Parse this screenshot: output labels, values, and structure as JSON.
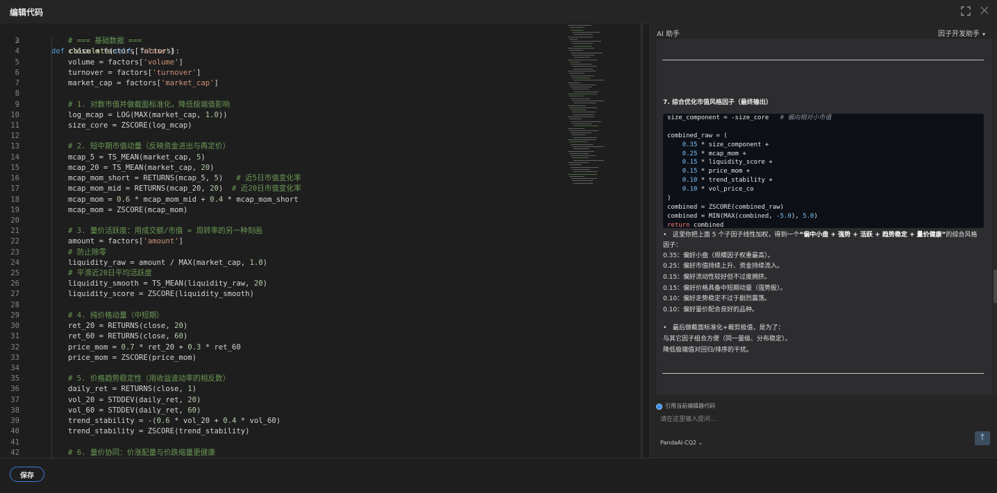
{
  "window": {
    "title": "编辑代码"
  },
  "editor": {
    "lines": [
      {
        "n": "2",
        "t": [
          [
            "",
            ""
          ]
        ]
      },
      {
        "n": "3",
        "t": [
          [
            "cm",
            "# === 基础数据 ==="
          ]
        ]
      },
      {
        "n": "4",
        "t": [
          [
            "",
            "close = factors["
          ],
          [
            "str",
            "'close'"
          ],
          [
            "",
            "]"
          ]
        ]
      },
      {
        "n": "5",
        "t": [
          [
            "",
            "volume = factors["
          ],
          [
            "str",
            "'volume'"
          ],
          [
            "",
            "]"
          ]
        ]
      },
      {
        "n": "6",
        "t": [
          [
            "",
            "turnover = factors["
          ],
          [
            "str",
            "'turnover'"
          ],
          [
            "",
            "]"
          ]
        ]
      },
      {
        "n": "7",
        "t": [
          [
            "",
            "market_cap = factors["
          ],
          [
            "str",
            "'market_cap'"
          ],
          [
            "",
            "]"
          ]
        ]
      },
      {
        "n": "8",
        "t": [
          [
            "",
            ""
          ]
        ]
      },
      {
        "n": "9",
        "t": [
          [
            "cm",
            "# 1. 对数市值并做截面标准化，降低极端值影响"
          ]
        ]
      },
      {
        "n": "10",
        "t": [
          [
            "",
            "log_mcap = LOG(MAX(market_cap, "
          ],
          [
            "num",
            "1.0"
          ],
          [
            "",
            "))"
          ]
        ]
      },
      {
        "n": "11",
        "t": [
          [
            "",
            "size_core = ZSCORE(log_mcap)"
          ]
        ]
      },
      {
        "n": "12",
        "t": [
          [
            "",
            ""
          ]
        ]
      },
      {
        "n": "13",
        "t": [
          [
            "cm",
            "# 2. 短中期市值动量（反映资金进出与再定价）"
          ]
        ]
      },
      {
        "n": "14",
        "t": [
          [
            "",
            "mcap_5 = TS_MEAN(market_cap, "
          ],
          [
            "num",
            "5"
          ],
          [
            "",
            ")"
          ]
        ]
      },
      {
        "n": "15",
        "t": [
          [
            "",
            "mcap_20 = TS_MEAN(market_cap, "
          ],
          [
            "num",
            "20"
          ],
          [
            "",
            ")"
          ]
        ]
      },
      {
        "n": "16",
        "t": [
          [
            "",
            "mcap_mom_short = RETURNS(mcap_5, "
          ],
          [
            "num",
            "5"
          ],
          [
            "",
            ")   "
          ],
          [
            "cm",
            "# 近5日市值变化率"
          ]
        ]
      },
      {
        "n": "17",
        "t": [
          [
            "",
            "mcap_mom_mid = RETURNS(mcap_20, "
          ],
          [
            "num",
            "20"
          ],
          [
            "",
            ")  "
          ],
          [
            "cm",
            "# 近20日市值变化率"
          ]
        ]
      },
      {
        "n": "18",
        "t": [
          [
            "",
            "mcap_mom = "
          ],
          [
            "num",
            "0.6"
          ],
          [
            "",
            " * mcap_mom_mid + "
          ],
          [
            "num",
            "0.4"
          ],
          [
            "",
            " * mcap_mom_short"
          ]
        ]
      },
      {
        "n": "19",
        "t": [
          [
            "",
            "mcap_mom = ZSCORE(mcap_mom)"
          ]
        ]
      },
      {
        "n": "20",
        "t": [
          [
            "",
            ""
          ]
        ]
      },
      {
        "n": "21",
        "t": [
          [
            "cm",
            "# 3. 量价活跃度：用成交额/市值 ≈ 周转率的另一种刻画"
          ]
        ]
      },
      {
        "n": "22",
        "t": [
          [
            "",
            "amount = factors["
          ],
          [
            "str",
            "'amount'"
          ],
          [
            "",
            "]"
          ]
        ]
      },
      {
        "n": "23",
        "t": [
          [
            "cm",
            "# 防止除零"
          ]
        ]
      },
      {
        "n": "24",
        "t": [
          [
            "",
            "liquidity_raw = amount / MAX(market_cap, "
          ],
          [
            "num",
            "1.0"
          ],
          [
            "",
            ")"
          ]
        ]
      },
      {
        "n": "25",
        "t": [
          [
            "cm",
            "# 平滑近20日平均活跃度"
          ]
        ]
      },
      {
        "n": "26",
        "t": [
          [
            "",
            "liquidity_smooth = TS_MEAN(liquidity_raw, "
          ],
          [
            "num",
            "20"
          ],
          [
            "",
            ")"
          ]
        ]
      },
      {
        "n": "27",
        "t": [
          [
            "",
            "liquidity_score = ZSCORE(liquidity_smooth)"
          ]
        ]
      },
      {
        "n": "28",
        "t": [
          [
            "",
            ""
          ]
        ]
      },
      {
        "n": "29",
        "t": [
          [
            "cm",
            "# 4. 纯价格动量（中短期）"
          ]
        ]
      },
      {
        "n": "30",
        "t": [
          [
            "",
            "ret_20 = RETURNS(close, "
          ],
          [
            "num",
            "20"
          ],
          [
            "",
            ")"
          ]
        ]
      },
      {
        "n": "31",
        "t": [
          [
            "",
            "ret_60 = RETURNS(close, "
          ],
          [
            "num",
            "60"
          ],
          [
            "",
            ")"
          ]
        ]
      },
      {
        "n": "32",
        "t": [
          [
            "",
            "price_mom = "
          ],
          [
            "num",
            "0.7"
          ],
          [
            "",
            " * ret_20 + "
          ],
          [
            "num",
            "0.3"
          ],
          [
            "",
            " * ret_60"
          ]
        ]
      },
      {
        "n": "33",
        "t": [
          [
            "",
            "price_mom = ZSCORE(price_mom)"
          ]
        ]
      },
      {
        "n": "34",
        "t": [
          [
            "",
            ""
          ]
        ]
      },
      {
        "n": "35",
        "t": [
          [
            "cm",
            "# 5. 价格趋势稳定性（用收益波动率的相反数）"
          ]
        ]
      },
      {
        "n": "36",
        "t": [
          [
            "",
            "daily_ret = RETURNS(close, "
          ],
          [
            "num",
            "1"
          ],
          [
            "",
            ")"
          ]
        ]
      },
      {
        "n": "37",
        "t": [
          [
            "",
            "vol_20 = STDDEV(daily_ret, "
          ],
          [
            "num",
            "20"
          ],
          [
            "",
            ")"
          ]
        ]
      },
      {
        "n": "38",
        "t": [
          [
            "",
            "vol_60 = STDDEV(daily_ret, "
          ],
          [
            "num",
            "60"
          ],
          [
            "",
            ")"
          ]
        ]
      },
      {
        "n": "39",
        "t": [
          [
            "",
            "trend_stability = -("
          ],
          [
            "num",
            "0.6"
          ],
          [
            "",
            " * vol_20 + "
          ],
          [
            "num",
            "0.4"
          ],
          [
            "",
            " * vol_60)"
          ]
        ]
      },
      {
        "n": "40",
        "t": [
          [
            "",
            "trend_stability = ZSCORE(trend_stability)"
          ]
        ]
      },
      {
        "n": "41",
        "t": [
          [
            "",
            ""
          ]
        ]
      },
      {
        "n": "42",
        "t": [
          [
            "cm",
            "# 6. 量价协同：价涨配量与价跌缩量更健康"
          ]
        ]
      }
    ],
    "def_line": {
      "kw": "def",
      "name": "calculate",
      "open": "(",
      "self": "self",
      "rest": ", factors):"
    }
  },
  "ai": {
    "title": "AI 助手",
    "mode": "因子开发助手",
    "section_heading": "7. 综合优化市值风格因子（最终输出）",
    "code": [
      [
        [
          "",
          "size_component = -size_core   "
        ],
        [
          "cm",
          "# 偏向相对小市值"
        ]
      ],
      [
        [
          "",
          ""
        ]
      ],
      [
        [
          "",
          "combined_raw = ("
        ]
      ],
      [
        [
          "",
          "    "
        ],
        [
          "num",
          "0.35"
        ],
        [
          "",
          " * size_component +"
        ]
      ],
      [
        [
          "",
          "    "
        ],
        [
          "num",
          "0.25"
        ],
        [
          "",
          " * mcap_mom +"
        ]
      ],
      [
        [
          "",
          "    "
        ],
        [
          "num",
          "0.15"
        ],
        [
          "",
          " * liquidity_score +"
        ]
      ],
      [
        [
          "",
          "    "
        ],
        [
          "num",
          "0.15"
        ],
        [
          "",
          " * price_mom +"
        ]
      ],
      [
        [
          "",
          "    "
        ],
        [
          "num",
          "0.10"
        ],
        [
          "",
          " * trend_stability +"
        ]
      ],
      [
        [
          "",
          "    "
        ],
        [
          "num",
          "0.10"
        ],
        [
          "",
          " * vol_price_co"
        ]
      ],
      [
        [
          "",
          ")"
        ]
      ],
      [
        [
          "",
          "combined = ZSCORE(combined_raw)"
        ]
      ],
      [
        [
          "",
          "combined = MIN(MAX(combined, "
        ],
        [
          "num",
          "-5.0"
        ],
        [
          "",
          "), "
        ],
        [
          "num",
          "5.0"
        ],
        [
          "",
          ")"
        ]
      ],
      [
        [
          "kw",
          "return"
        ],
        [
          "",
          " combined"
        ]
      ]
    ],
    "summary": {
      "bullet1_pre": "这里你把上面 5 个子因子线性加权，得到一个",
      "bullet1_bold": "“偏中小盘 + 强势 + 活跃 + 趋势稳定 + 量价健康”",
      "bullet1_post": "的综合风格",
      "bullet1_cont": "因子：",
      "weights": [
        "0.35：偏好小盘（规模因子权重最高）。",
        "0.25：偏好市值持续上升、资金持续流入。",
        "0.15：偏好流动性较好但不过度拥挤。",
        "0.15：偏好价格具备中短期动量（强势股）。",
        "0.10：偏好走势稳定不过于剧烈震荡。",
        "0.10：偏好量价配合良好的品种。"
      ],
      "bullet2": "最后做截面标准化+裁剪极值，是为了：",
      "reasons": [
        "与其它因子组合方便（同一量级、分布稳定）。",
        "降低极端值对回归/排序的干扰。"
      ]
    },
    "reference_label": "引用当前编辑器代码",
    "input_placeholder": "请在这里输入提问...",
    "model": "PandaAI-CQ2"
  },
  "footer": {
    "save_label": "保存"
  },
  "colors": {
    "accent": "#3b7ad9",
    "background": "#1e1e1e"
  }
}
